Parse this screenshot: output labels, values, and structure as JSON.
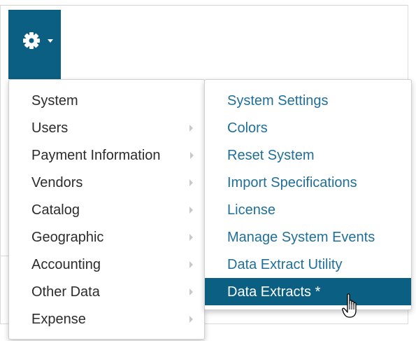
{
  "toolbar": {
    "settings_icon": "gear-icon",
    "dropdown_icon": "caret-down-icon",
    "accent_color": "#0a5f82"
  },
  "menu": {
    "items": [
      {
        "label": "System",
        "has_submenu": false,
        "active": true
      },
      {
        "label": "Users",
        "has_submenu": true
      },
      {
        "label": "Payment Information",
        "has_submenu": true
      },
      {
        "label": "Vendors",
        "has_submenu": true
      },
      {
        "label": "Catalog",
        "has_submenu": true
      },
      {
        "label": "Geographic",
        "has_submenu": true
      },
      {
        "label": "Accounting",
        "has_submenu": true
      },
      {
        "label": "Other Data",
        "has_submenu": true
      },
      {
        "label": "Expense",
        "has_submenu": true
      }
    ]
  },
  "submenu": {
    "link_color": "#1f6f99",
    "items": [
      {
        "label": "System Settings"
      },
      {
        "label": "Colors"
      },
      {
        "label": "Reset System"
      },
      {
        "label": "Import Specifications"
      },
      {
        "label": "License"
      },
      {
        "label": "Manage System Events"
      },
      {
        "label": "Data Extract Utility"
      },
      {
        "label": "Data Extracts *",
        "highlighted": true
      }
    ]
  },
  "cursor": {
    "icon": "hand-pointer-icon"
  }
}
